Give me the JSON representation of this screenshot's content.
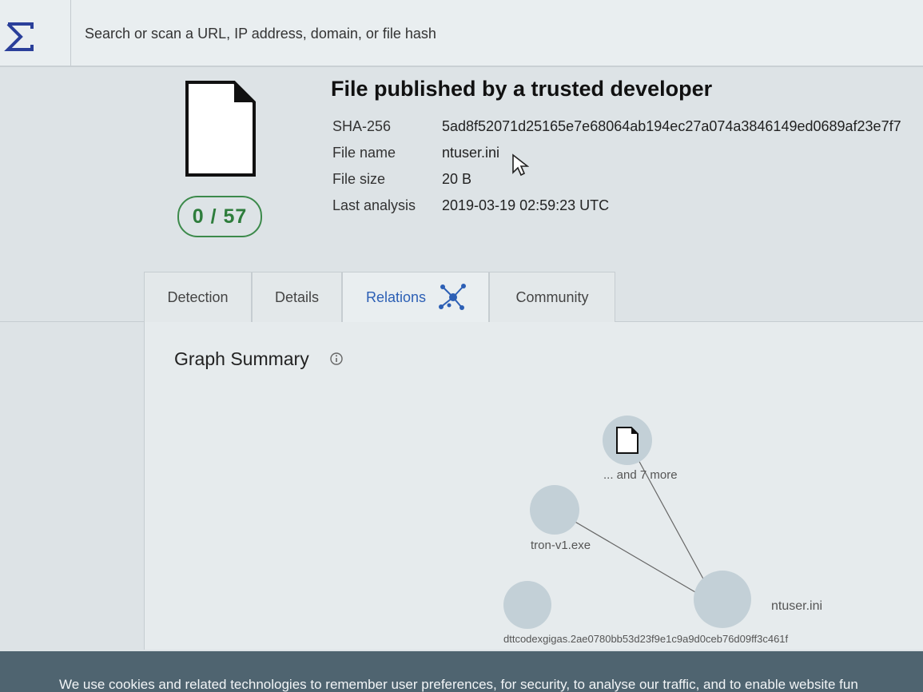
{
  "search": {
    "placeholder": "Search or scan a URL, IP address, domain, or file hash"
  },
  "summary": {
    "title": "File published by a trusted developer",
    "score": "0 / 57",
    "rows": [
      {
        "label": "SHA-256",
        "value": "5ad8f52071d25165e7e68064ab194ec27a074a3846149ed0689af23e7f7"
      },
      {
        "label": "File name",
        "value": "ntuser.ini"
      },
      {
        "label": "File size",
        "value": "20 B"
      },
      {
        "label": "Last analysis",
        "value": "2019-03-19 02:59:23 UTC"
      }
    ]
  },
  "tabs": [
    {
      "label": "Detection"
    },
    {
      "label": "Details"
    },
    {
      "label": "Relations",
      "active": true
    },
    {
      "label": "Community"
    }
  ],
  "graph": {
    "title": "Graph Summary",
    "nodes": {
      "more": "... and 7 more",
      "tron": "tron-v1.exe",
      "ntuser": "ntuser.ini",
      "dttcodex": "dttcodexgigas.2ae0780bb53d23f9e1c9a9d0ceb76d09ff3c461f"
    }
  },
  "cookie": {
    "text": "We use cookies and related technologies to remember user preferences, for security, to analyse our traffic, and to enable website fun"
  },
  "colors": {
    "accent": "#2c5fb5",
    "clean": "#2e7d3c",
    "banner": "#4f6470"
  }
}
